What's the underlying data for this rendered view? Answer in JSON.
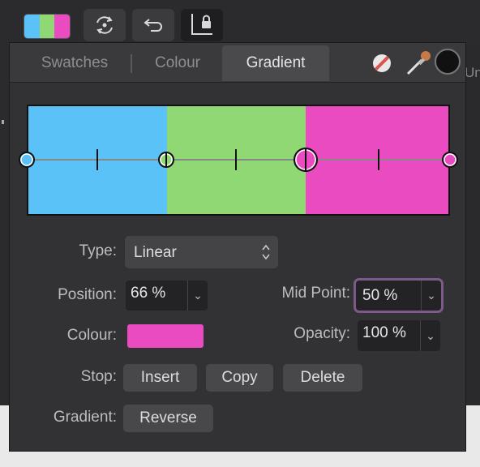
{
  "toolbar": {
    "swatch_colors": [
      "#5ac2f7",
      "#8fd873",
      "#ea4bc0"
    ],
    "buttons": [
      "swap-fill-stroke-icon",
      "reverse-icon",
      "lock-icon"
    ]
  },
  "background": {
    "right_text": "Un"
  },
  "tabs": [
    {
      "label": "Swatches",
      "active": false
    },
    {
      "label": "Colour",
      "active": false
    },
    {
      "label": "Gradient",
      "active": true
    }
  ],
  "gradient": {
    "stops": [
      {
        "color": "#5ac2f7",
        "position": 0
      },
      {
        "color": "#8fd873",
        "position": 33
      },
      {
        "color": "#ea4bc0",
        "position": 66
      }
    ]
  },
  "form": {
    "type_label": "Type:",
    "type_value": "Linear",
    "position_label": "Position:",
    "position_value": "66 %",
    "midpoint_label": "Mid Point:",
    "midpoint_value": "50 %",
    "colour_label": "Colour:",
    "colour_value": "#ea4bc0",
    "opacity_label": "Opacity:",
    "opacity_value": "100 %",
    "stop_label": "Stop:",
    "insert_label": "Insert",
    "copy_label": "Copy",
    "delete_label": "Delete",
    "gradient_label": "Gradient:",
    "reverse_label": "Reverse"
  },
  "colors": {
    "panel_bg": "#323234",
    "focus_ring": "#7d5a8a",
    "no_fill_slash": "#d9534f"
  }
}
